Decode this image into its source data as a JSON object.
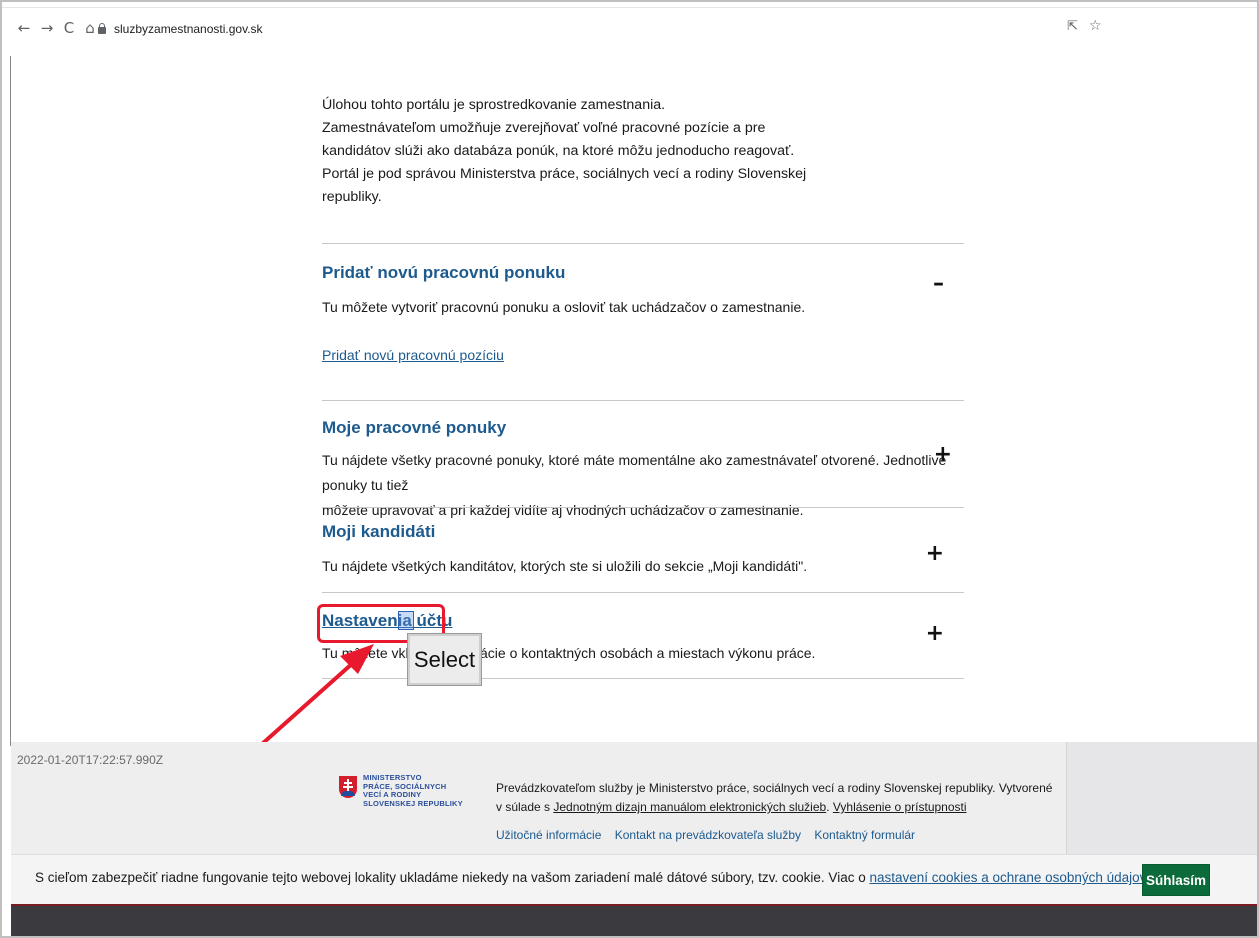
{
  "browser": {
    "back_icon": "←",
    "forward_icon": "→",
    "reload_icon": "C",
    "home_icon": "⌂",
    "url": "sluzbyzamestnanosti.gov.sk",
    "share_icon": "⇱",
    "star_icon": "☆"
  },
  "intro": {
    "lines": [
      "Úlohou tohto portálu je sprostredkovanie zamestnania.",
      "Zamestnávateľom umožňuje zverejňovať voľné pracovné pozície a pre",
      "kandidátov slúži ako databáza ponúk, na ktoré môžu jednoducho reagovať.",
      "Portál je pod správou Ministerstva práce, sociálnych vecí a rodiny Slovenskej",
      "republiky."
    ]
  },
  "sections": [
    {
      "title": "Pridať novú pracovnú ponuku",
      "desc": "Tu môžete vytvoriť pracovnú ponuku a osloviť tak uchádzačov o zamestnanie.",
      "toggle": "–",
      "link": "Pridať novú pracovnú pozíciu"
    },
    {
      "title": "Moje pracovné ponuky",
      "desc_lines": [
        "Tu nájdete všetky pracovné ponuky, ktoré máte momentálne ako zamestnávateľ otvorené. Jednotlivé ponuky tu tiež",
        "môžete upravovať a pri každej vidíte aj vhodných uchádzačov o zamestnanie."
      ],
      "toggle": "+"
    },
    {
      "title": "Moji kandidáti",
      "desc": "Tu nájdete všetkých kanditátov, ktorých ste si uložili do sekcie „Moji kandidáti\".",
      "toggle": "+"
    },
    {
      "title": "Nastavenia účtu",
      "desc": "Tu môžete vkladať informácie o kontaktných osobách a miestach výkonu práce.",
      "toggle": "+"
    }
  ],
  "annotation": {
    "tooltip": "Select",
    "highlight_color": "#e8192c"
  },
  "footer": {
    "timestamp": "2022-01-20T17:22:57.990Z",
    "logo_lines": [
      "MINISTERSTVO",
      "PRÁCE, SOCIÁLNYCH",
      "VECÍ A RODINY",
      "SLOVENSKEJ REPUBLIKY"
    ],
    "text_part1": "Prevádzkovateľom služby je Ministerstvo práce, sociálnych vecí a rodiny Slovenskej republiky. Vytvorené",
    "text_part2": "v súlade s",
    "text_link1": "Jednotným dizajn manuálom elektronických služieb",
    "text_dot": ".",
    "text_link2": "Vyhlásenie o prístupnosti",
    "links": [
      "Užitočné informácie",
      "Kontakt na prevádzkovateľa služby",
      "Kontaktný formulár"
    ]
  },
  "cookie": {
    "text": "S cieľom zabezpečiť riadne fungovanie tejto webovej lokality ukladáme niekedy na vašom zariadení malé dátové súbory, tzv. cookie. Viac o ",
    "link": "nastavení cookies a ochrane osobných údajov",
    "after": ".",
    "button": "Súhlasím"
  },
  "colors": {
    "link_blue": "#1d5a8e",
    "agree_green": "#0b6b3a",
    "arrow_red": "#e8192c"
  }
}
